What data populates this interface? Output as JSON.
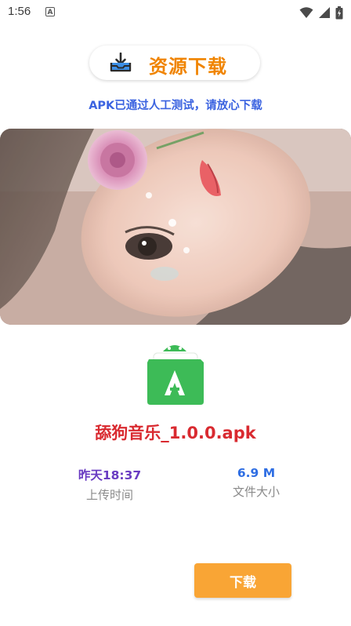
{
  "status_bar": {
    "time": "1:56",
    "notification_icon": "a-box-icon",
    "icons": [
      "wifi-icon",
      "signal-icon",
      "battery-icon"
    ]
  },
  "header": {
    "icon": "download-tray-icon",
    "title": "资源下载"
  },
  "notice": "APK已通过人工测试，请放心下载",
  "banner": {
    "image": "portrait-photo-banner"
  },
  "app": {
    "icon": "android-folder-icon",
    "name": "舔狗音乐_1.0.0.apk"
  },
  "info": {
    "upload_time_value": "昨天18:37",
    "upload_time_label": "上传时间",
    "file_size_value": "6.9 M",
    "file_size_label": "文件大小"
  },
  "actions": {
    "download_label": "下载"
  },
  "colors": {
    "accent_orange": "#f08400",
    "button_orange": "#f9a535",
    "notice_blue": "#3b63e0",
    "app_name_red": "#d92a30",
    "time_purple": "#6a3cc2",
    "size_blue": "#2f6ee3",
    "android_green": "#3dbb57"
  }
}
